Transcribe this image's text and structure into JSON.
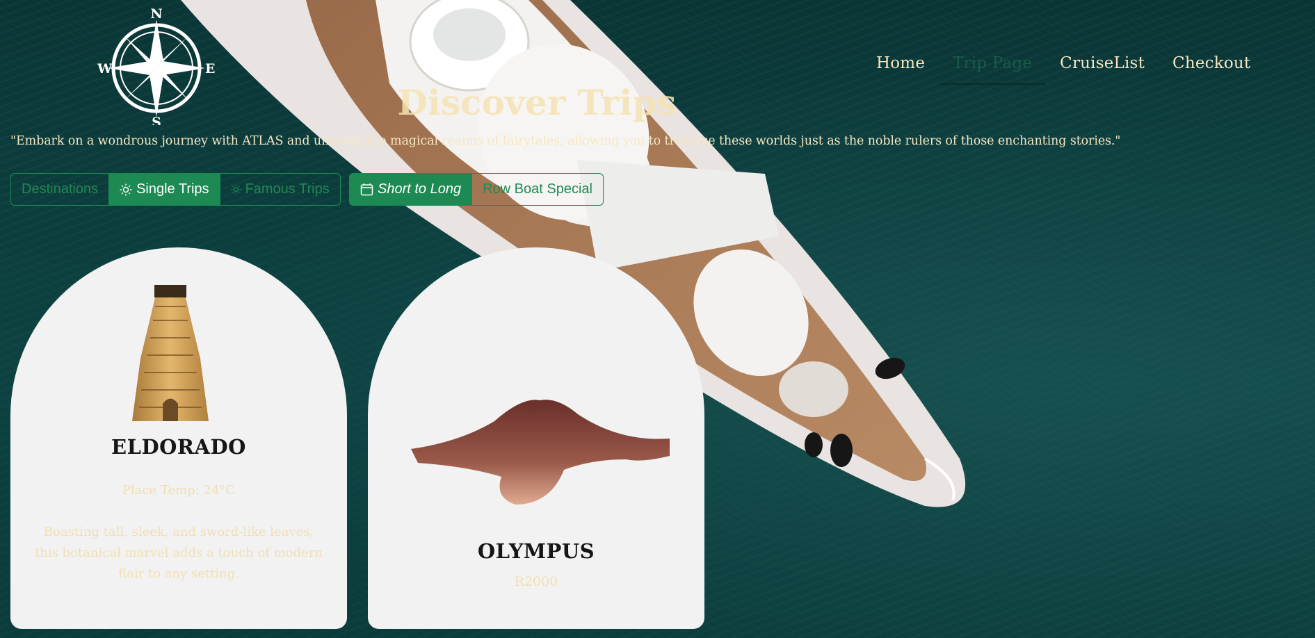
{
  "logo": {
    "north": "N",
    "south": "S",
    "east": "E",
    "west": "W"
  },
  "nav": {
    "items": [
      {
        "label": "Home",
        "active": false
      },
      {
        "label": "Trip Page",
        "active": true
      },
      {
        "label": "CruiseList",
        "active": false
      },
      {
        "label": "Checkout",
        "active": false
      }
    ]
  },
  "page": {
    "title": "Discover Trips",
    "subtitle": "\"Embark on a wondrous journey with ATLAS and uncover the magical realms of fairytales, allowing you to traverse these worlds just as the noble rulers of those enchanting stories.\""
  },
  "filters": {
    "group1": [
      {
        "label": "Destinations",
        "icon": "",
        "active": false
      },
      {
        "label": "Single Trips",
        "icon": "sun-icon",
        "active": true
      },
      {
        "label": "Famous Trips",
        "icon": "sun-icon",
        "active": false
      }
    ],
    "group2": [
      {
        "label": "Short to Long",
        "icon": "calendar-icon",
        "active": true
      },
      {
        "label": "Row Boat Special",
        "icon": "",
        "active": false
      }
    ]
  },
  "cards": [
    {
      "name": "ELDORADO",
      "temp": "Place Temp: 24°C",
      "description": "Boasting tall, sleek, and sword-like leaves, this botanical marvel adds a touch of modern flair to any setting.",
      "image": "temple-tower-image"
    },
    {
      "name": "OLYMPUS",
      "price": "R2000",
      "image": "mountain-image"
    }
  ],
  "colors": {
    "accent": "#1e8a53",
    "cream": "#f6e7c2",
    "sea": "#0f4545",
    "card": "#f2f2f2"
  }
}
